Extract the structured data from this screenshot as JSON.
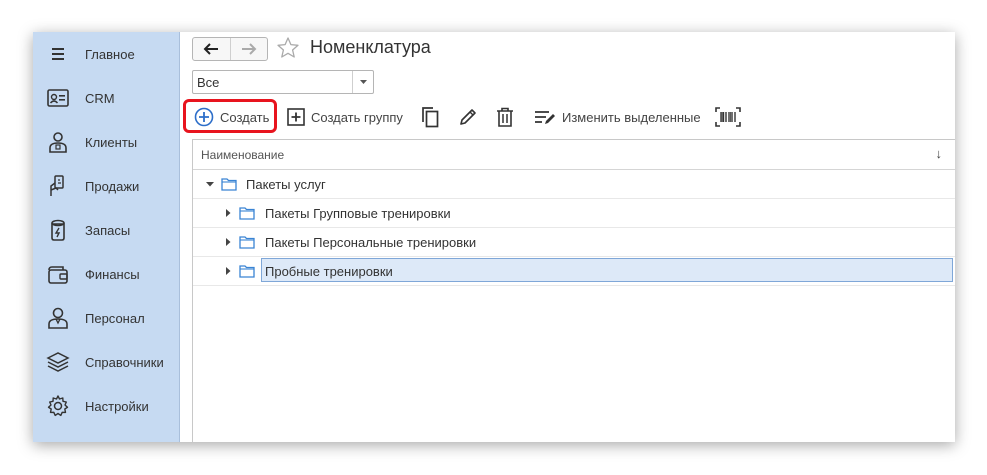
{
  "sidebar": {
    "items": [
      {
        "label": "Главное",
        "icon": "menu-lines-icon"
      },
      {
        "label": "CRM",
        "icon": "id-card-icon"
      },
      {
        "label": "Клиенты",
        "icon": "client-person-icon"
      },
      {
        "label": "Продажи",
        "icon": "sales-hand-icon"
      },
      {
        "label": "Запасы",
        "icon": "stock-jar-icon"
      },
      {
        "label": "Финансы",
        "icon": "wallet-icon"
      },
      {
        "label": "Персонал",
        "icon": "staff-person-icon"
      },
      {
        "label": "Справочники",
        "icon": "reference-books-icon"
      },
      {
        "label": "Настройки",
        "icon": "gear-icon"
      }
    ]
  },
  "header": {
    "title": "Номенклатура"
  },
  "filter": {
    "selected": "Все"
  },
  "toolbar": {
    "create_label": "Создать",
    "create_group_label": "Создать группу",
    "edit_selected_label": "Изменить выделенные"
  },
  "table": {
    "column_header": "Наименование",
    "sort_indicator": "↓",
    "rows": [
      {
        "label": "Пакеты услуг",
        "level": 0,
        "expanded": true
      },
      {
        "label": "Пакеты Групповые тренировки",
        "level": 1,
        "expanded": false
      },
      {
        "label": "Пакеты Персональные тренировки",
        "level": 1,
        "expanded": false
      },
      {
        "label": "Пробные тренировки",
        "level": 1,
        "expanded": false,
        "selected": true
      }
    ]
  },
  "colors": {
    "sidebar_bg": "#c6daf2",
    "accent": "#2d6ec9",
    "highlight_border": "#e8141e",
    "selection_bg": "#dde9f8"
  }
}
